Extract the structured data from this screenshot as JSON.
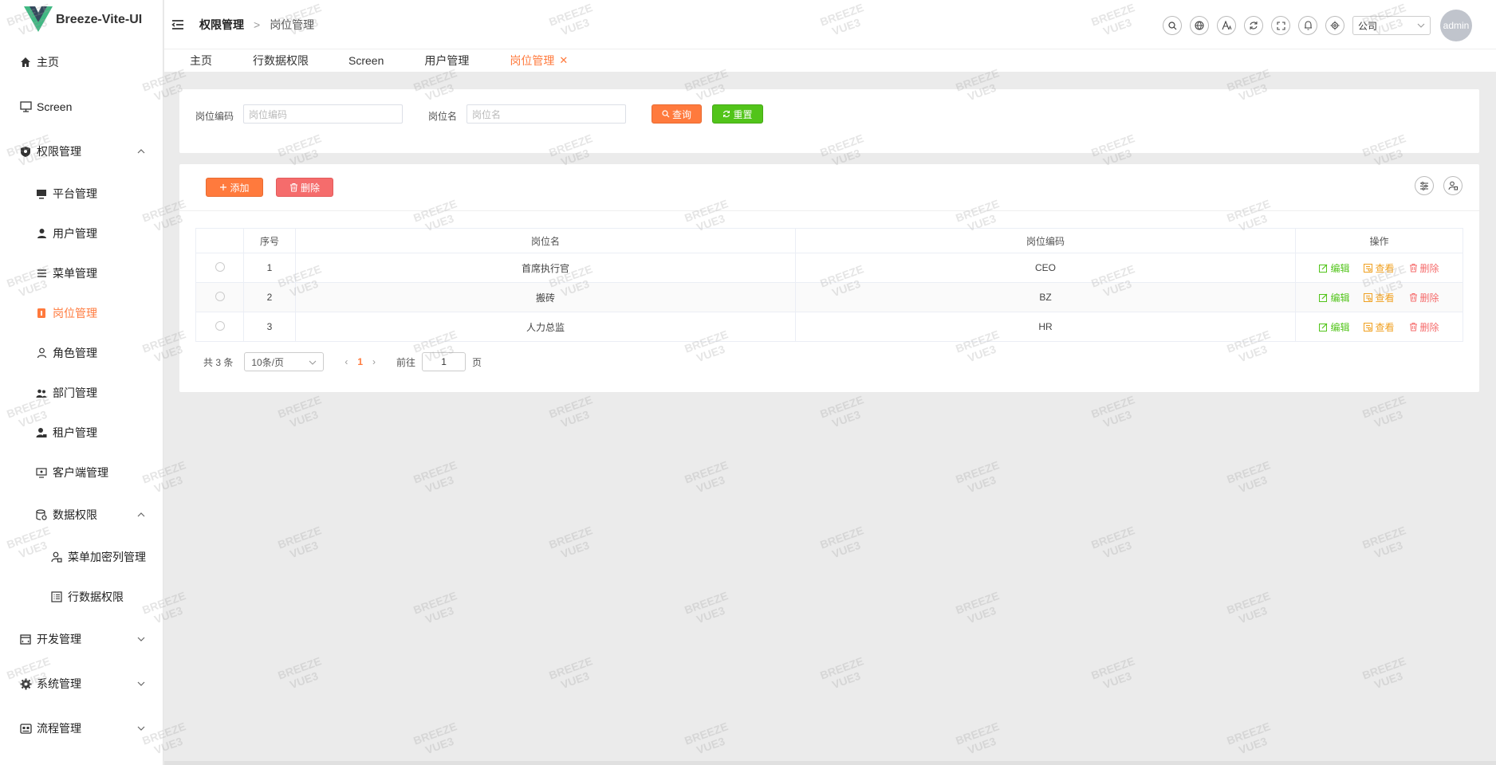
{
  "app": {
    "title": "Breeze-Vite-UI"
  },
  "sidebar": {
    "items": [
      {
        "label": "主页",
        "icon": "home-icon"
      },
      {
        "label": "Screen",
        "icon": "monitor-icon"
      },
      {
        "label": "权限管理",
        "icon": "shield-icon"
      },
      {
        "label": "平台管理",
        "icon": "desktop-icon"
      },
      {
        "label": "用户管理",
        "icon": "user-icon"
      },
      {
        "label": "菜单管理",
        "icon": "list-icon"
      },
      {
        "label": "岗位管理",
        "icon": "badge-icon"
      },
      {
        "label": "角色管理",
        "icon": "user-outline-icon"
      },
      {
        "label": "部门管理",
        "icon": "group-icon"
      },
      {
        "label": "租户管理",
        "icon": "user-lock-icon"
      },
      {
        "label": "客户端管理",
        "icon": "screen-icon"
      },
      {
        "label": "数据权限",
        "icon": "database-icon"
      },
      {
        "label": "菜单加密列管理",
        "icon": "user-key-icon"
      },
      {
        "label": "行数据权限",
        "icon": "table-list-icon"
      },
      {
        "label": "开发管理",
        "icon": "code-icon"
      },
      {
        "label": "系统管理",
        "icon": "gear-icon"
      },
      {
        "label": "流程管理",
        "icon": "flow-icon"
      }
    ]
  },
  "header": {
    "breadcrumb": [
      "权限管理",
      "岗位管理"
    ],
    "company": "公司",
    "avatar": "admin"
  },
  "tabs": [
    "主页",
    "行数据权限",
    "Screen",
    "用户管理",
    "岗位管理"
  ],
  "search": {
    "code_label": "岗位编码",
    "code_placeholder": "岗位编码",
    "name_label": "岗位名",
    "name_placeholder": "岗位名",
    "query": "查询",
    "reset": "重置"
  },
  "toolbar": {
    "add": "添加",
    "delete": "删除"
  },
  "table": {
    "headers": [
      "序号",
      "岗位名",
      "岗位编码",
      "操作"
    ],
    "rows": [
      {
        "index": "1",
        "name": "首席执行官",
        "code": "CEO"
      },
      {
        "index": "2",
        "name": "搬砖",
        "code": "BZ"
      },
      {
        "index": "3",
        "name": "人力总监",
        "code": "HR"
      }
    ],
    "ops": {
      "edit": "编辑",
      "view": "查看",
      "delete": "删除"
    }
  },
  "pager": {
    "total": "共 3 条",
    "page_size": "10条/页",
    "current": "1",
    "goto_prefix": "前往",
    "goto_value": "1",
    "goto_suffix": "页"
  },
  "watermark": {
    "line1": "BREEZE",
    "line2": "VUE3"
  },
  "colors": {
    "accent": "#ff7a3d",
    "success": "#52c41a",
    "danger": "#f56c6c",
    "warning": "#f0a020"
  }
}
